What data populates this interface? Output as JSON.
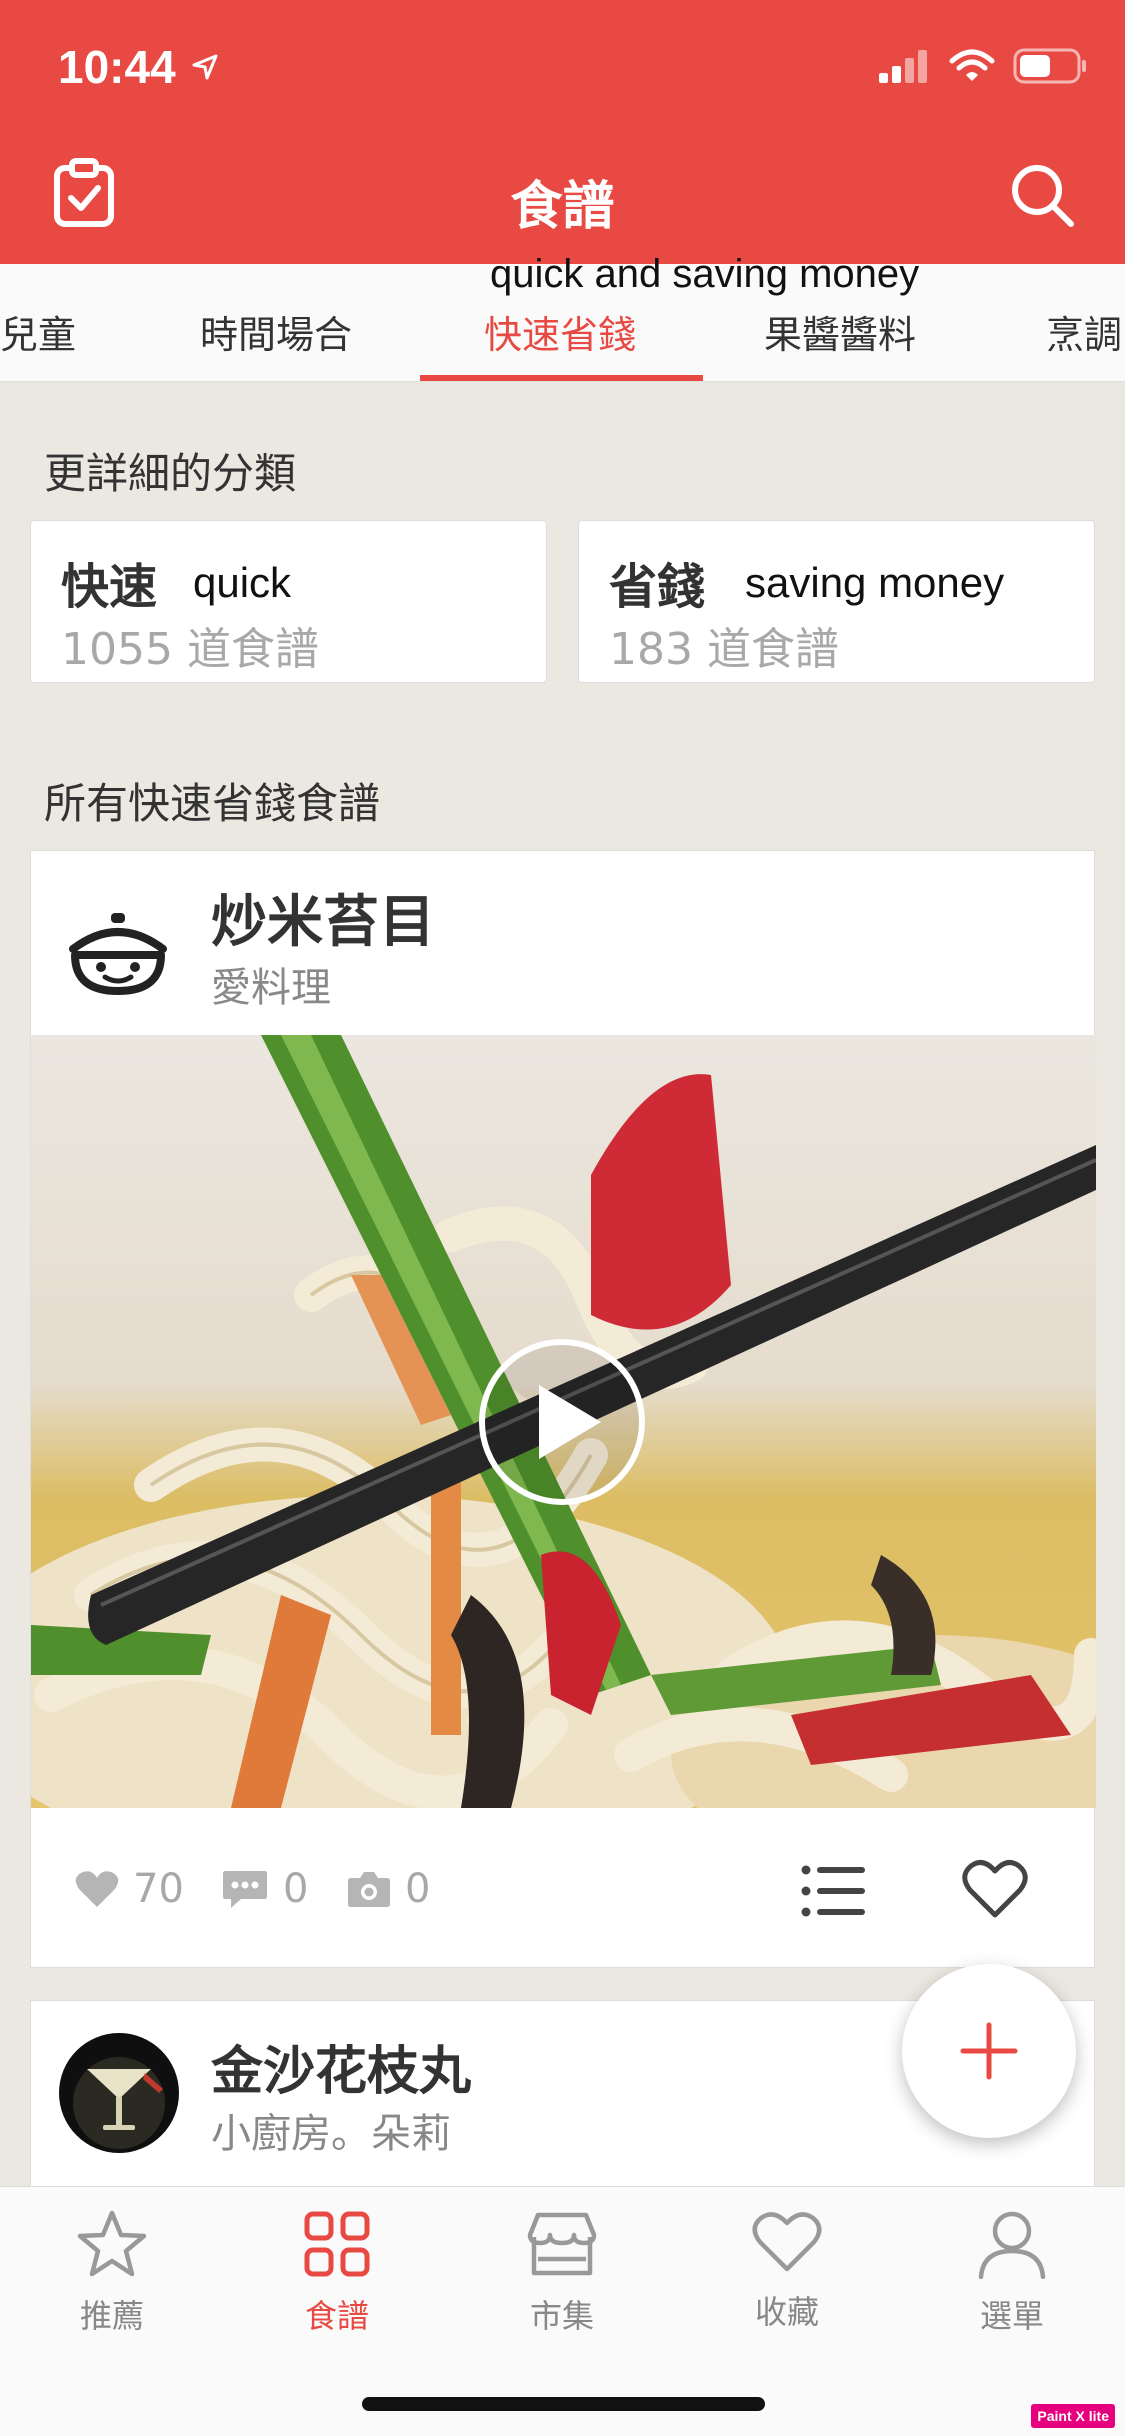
{
  "status_bar": {
    "time": "10:44"
  },
  "nav": {
    "title": "食譜"
  },
  "tabs": [
    {
      "label": "兒童"
    },
    {
      "label": "時間場合"
    },
    {
      "label": "快速省錢",
      "active": true
    },
    {
      "label": "果醬醬料"
    },
    {
      "label": "烹調"
    }
  ],
  "annotations": {
    "tab_translation": "quick and saving money",
    "subcat_1_translation": "quick",
    "subcat_2_translation": "saving money"
  },
  "subcategories": {
    "title": "更詳細的分類",
    "items": [
      {
        "name": "快速",
        "count": "1055 道食譜"
      },
      {
        "name": "省錢",
        "count": "183 道食譜"
      }
    ]
  },
  "recipes": {
    "title": "所有快速省錢食譜",
    "items": [
      {
        "title": "炒米苔目",
        "author": "愛料理",
        "likes": "70",
        "comments": "0",
        "photos": "0"
      },
      {
        "title": "金沙花枝丸",
        "author": "小廚房。朵莉"
      }
    ]
  },
  "bottom_nav": [
    {
      "label": "推薦",
      "icon": "star-icon"
    },
    {
      "label": "食譜",
      "icon": "grid-icon",
      "active": true
    },
    {
      "label": "市集",
      "icon": "store-icon"
    },
    {
      "label": "收藏",
      "icon": "heart-icon"
    },
    {
      "label": "選單",
      "icon": "person-icon"
    }
  ],
  "watermark": "Paint X lite",
  "colors": {
    "brand": "#e84a43",
    "background": "#ebe8e1",
    "muted": "#a8a8a8"
  }
}
